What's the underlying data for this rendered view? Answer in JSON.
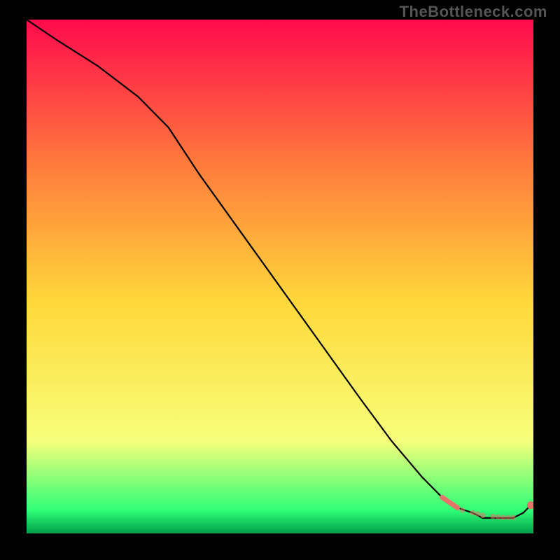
{
  "watermark": "TheBottleneck.com",
  "palette": {
    "top": "#ff0a4c",
    "mid_top": "#ff7a3c",
    "mid": "#ffd83a",
    "mid_low": "#f7ff7a",
    "low_green": "#2fff77",
    "bottom": "#00a04a",
    "marker": "#e5736a",
    "line": "#000000",
    "outer_bg": "#000000"
  },
  "chart_data": {
    "type": "line",
    "title": "",
    "xlabel": "",
    "ylabel": "",
    "xlim": [
      0,
      100
    ],
    "ylim": [
      0,
      100
    ],
    "series": [
      {
        "name": "curve",
        "x": [
          0,
          6,
          14,
          22,
          28,
          34,
          42,
          50,
          58,
          66,
          72,
          78,
          82,
          85,
          88,
          90,
          92,
          94,
          96,
          98,
          100
        ],
        "y": [
          100,
          96,
          91,
          85,
          79,
          70,
          59,
          48,
          37,
          26,
          18,
          11,
          7,
          5,
          4,
          3,
          3,
          3,
          3,
          4,
          6
        ]
      }
    ],
    "markers": {
      "name": "highlight-points",
      "x": [
        82,
        85,
        86,
        88,
        89,
        90,
        92,
        93,
        94,
        95,
        96,
        99.5
      ],
      "y": [
        7,
        5,
        4.5,
        4,
        3.8,
        3.5,
        3.3,
        3.2,
        3.1,
        3.1,
        3.1,
        5.5
      ]
    },
    "bold_segment": {
      "x": [
        82,
        85
      ],
      "y": [
        7,
        5
      ]
    }
  }
}
